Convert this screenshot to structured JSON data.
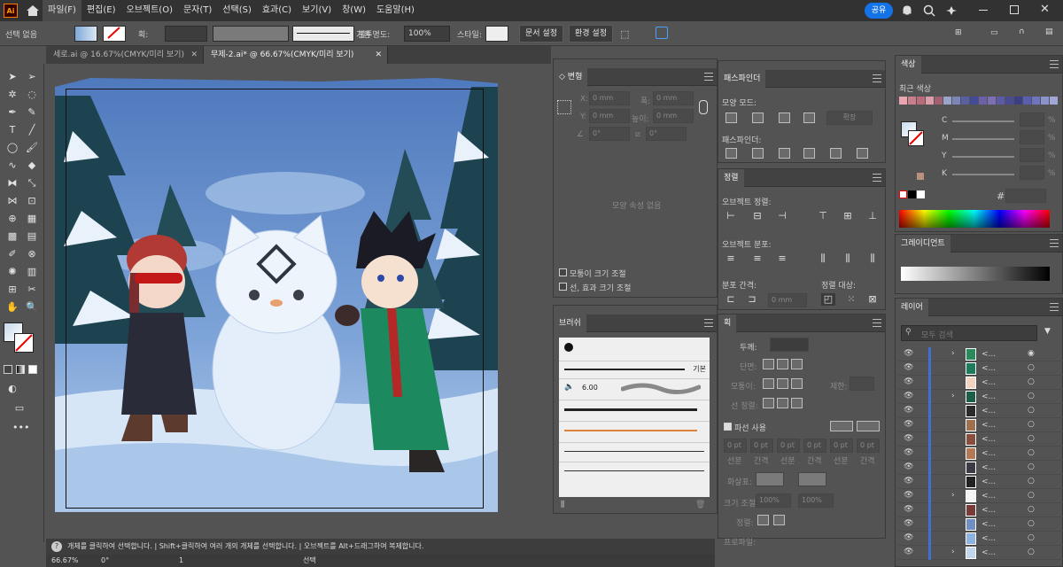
{
  "menubar": {
    "logo": "Ai",
    "items": [
      "파일(F)",
      "편집(E)",
      "오브젝트(O)",
      "문자(T)",
      "선택(S)",
      "효과(C)",
      "보기(V)",
      "창(W)",
      "도움말(H)"
    ],
    "share": "공유"
  },
  "control": {
    "no_selection": "선택 없음",
    "stroke_label": "획:",
    "stroke_style": "기본",
    "opacity_label": "불투명도:",
    "opacity_value": "100%",
    "style_label": "스타일:",
    "doc_setup": "문서 설정",
    "preferences": "환경 설정"
  },
  "tabs": [
    {
      "label": "세로.ai @ 16.67%(CMYK/미리 보기)"
    },
    {
      "label": "무제-2.ai* @ 66.67%(CMYK/미리 보기)"
    }
  ],
  "transform": {
    "title": "변형",
    "x_label": "X:",
    "x_value": "0 mm",
    "y_label": "Y:",
    "y_value": "0 mm",
    "w_label": "폭:",
    "w_value": "0 mm",
    "h_label": "높이:",
    "h_value": "0 mm",
    "angle": "0°",
    "shear": "0°",
    "no_shape": "모양 속성 없음",
    "scale_corners": "모퉁이 크기 조절",
    "scale_strokes": "선, 효과 크기 조절"
  },
  "pathfinder": {
    "title": "패스파인더",
    "shape_modes": "모양 모드:",
    "expand": "확장",
    "pathfinders": "패스파인더:"
  },
  "align": {
    "title": "정렬",
    "align_objects": "오브젝트 정렬:",
    "distribute_objects": "오브젝트 분포:",
    "distribute_spacing": "분포 간격:",
    "align_to": "정렬 대상:",
    "spacing_value": "0 mm"
  },
  "stroke": {
    "title": "획",
    "weight": "두께:",
    "cap": "단면:",
    "corner": "모퉁이:",
    "limit": "제한:",
    "align": "선 정렬:",
    "dashed": "파선 사용",
    "dash": "선분",
    "gap": "간격",
    "pt": "0 pt",
    "arrowheads": "화살표:",
    "scale": "크기 조절:",
    "scale_a": "100%",
    "scale_b": "100%",
    "align_arrow": "정렬:",
    "profile": "프로파일:"
  },
  "brushes": {
    "title": "브러쉬",
    "basic": "기본",
    "size": "6.00"
  },
  "color": {
    "title": "색상",
    "recent": "최근 색상",
    "channels": [
      "C",
      "M",
      "Y",
      "K"
    ],
    "percent": "%",
    "hash": "#"
  },
  "gradient": {
    "title": "그레이디언트"
  },
  "layers": {
    "title": "레이어",
    "search_placeholder": "모두 검색",
    "row_name": "<..."
  },
  "status": {
    "hint": "개체를 클릭하여 선택합니다.  |  Shift+클릭하여 여러 개의 개체를 선택합니다.  |  오브젝트를 Alt+드래그하여 복제합니다.",
    "zoom": "66.67%",
    "angle": "0°",
    "artboard": "1",
    "tool": "선택"
  },
  "colors": {
    "accent": "#1473e6",
    "chrome": "#323232",
    "panel": "#535353"
  }
}
